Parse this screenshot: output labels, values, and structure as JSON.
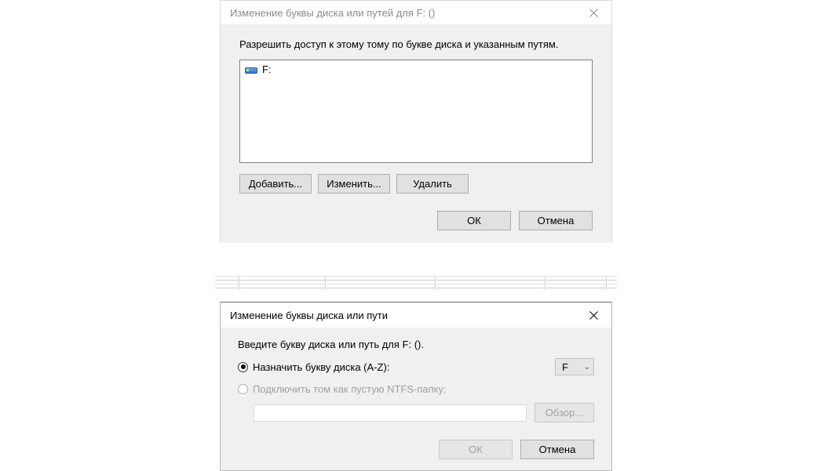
{
  "dialog1": {
    "title": "Изменение буквы диска или путей для F: ()",
    "prompt": "Разрешить доступ к этому тому по букве диска и указанным путям.",
    "list": {
      "items": [
        {
          "icon": "drive-icon",
          "label": "F:"
        }
      ]
    },
    "buttons": {
      "add": "Добавить...",
      "change": "Изменить...",
      "remove": "Удалить"
    },
    "ok": "ОК",
    "cancel": "Отмена"
  },
  "dialog2": {
    "title": "Изменение буквы диска или пути",
    "intro": "Введите букву диска или путь для F: ().",
    "optAssign": "Назначить букву диска (A-Z):",
    "optMount": "Подключить том как пустую NTFS-папку:",
    "selectedLetter": "F",
    "browse": "Обзор...",
    "ok": "ОК",
    "cancel": "Отмена"
  }
}
